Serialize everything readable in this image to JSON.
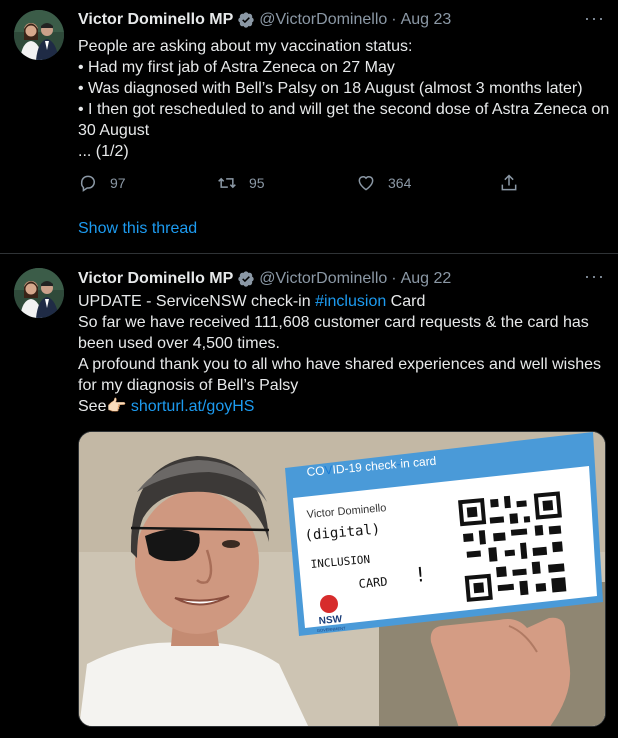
{
  "tweets": [
    {
      "author_name": "Victor Dominello MP",
      "handle": "@VictorDominello",
      "separator": "·",
      "date": "Aug 23",
      "lines": [
        "People are asking about my vaccination status:",
        "• Had my first jab of Astra Zeneca on 27 May",
        "• Was diagnosed with Bell’s Palsy on 18 August (almost 3 months later)",
        "• I then got rescheduled to and will get the second dose of Astra Zeneca on",
        "30 August",
        "... (1/2)"
      ],
      "replies": "97",
      "retweets": "95",
      "likes": "364",
      "show_thread": "Show this thread"
    },
    {
      "author_name": "Victor Dominello MP",
      "handle": "@VictorDominello",
      "separator": "·",
      "date": "Aug 22",
      "line1_prefix": "UPDATE - ServiceNSW check-in ",
      "line1_hashtag": "#inclusion",
      "line1_suffix": " Card",
      "lines": [
        "So far we have received 111,608 customer card requests & the card has",
        "been used over 4,500 times.",
        "A profound thank you to all who have shared experiences and well wishes",
        "for my diagnosis of Bell’s Palsy"
      ],
      "see_label": "See👉🏻 ",
      "link": "shorturl.at/goyHS",
      "media": {
        "card_header_a": "CO",
        "card_header_b": "ID-19 check",
        "card_header_c": "in card",
        "card_name": "Victor Dominello",
        "handwritten_1": "(digital)",
        "handwritten_2": "INCLUSION",
        "handwritten_3": "CARD",
        "handwritten_4": "!",
        "logo_text": "NSW",
        "logo_subtext": "GOVERNMENT"
      }
    }
  ],
  "colors": {
    "background": "#000000",
    "text": "#e7e9ea",
    "muted": "#8b98a5",
    "link": "#1d9bf0",
    "verified": "#8b98a5",
    "card_blue": "#4a9ad8"
  },
  "icons": {
    "verified": "verified-badge-icon",
    "more": "more-icon",
    "reply": "reply-icon",
    "retweet": "retweet-icon",
    "like": "heart-icon",
    "share": "share-icon",
    "logo": "nsw-waratah-icon"
  }
}
